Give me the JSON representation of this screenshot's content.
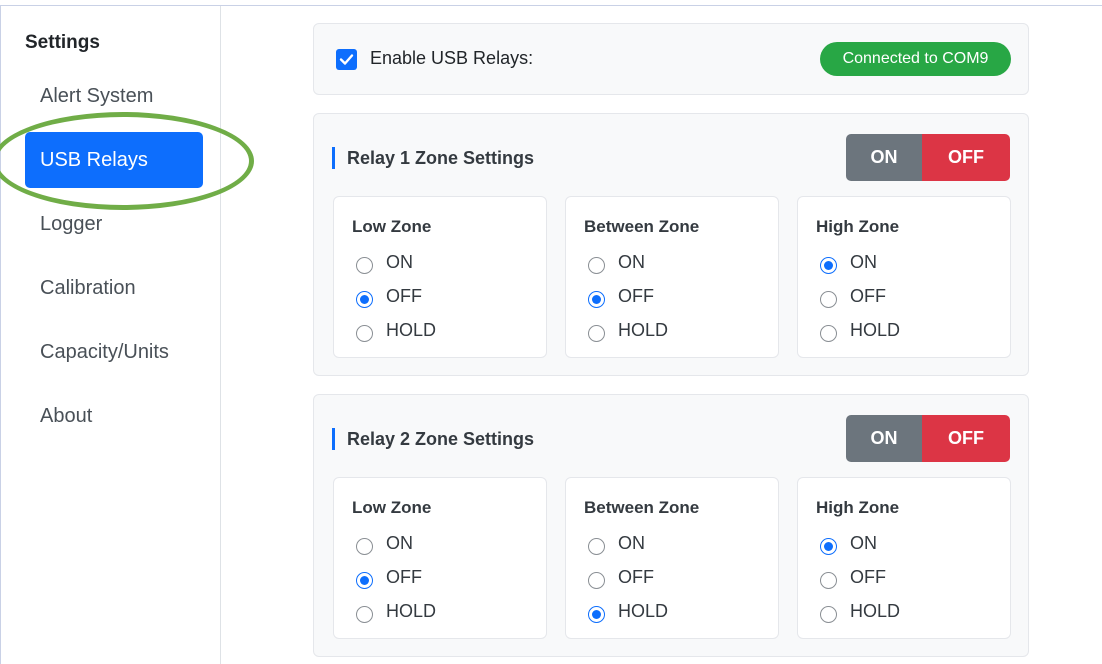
{
  "sidebar": {
    "title": "Settings",
    "items": [
      {
        "label": "Alert System",
        "active": false
      },
      {
        "label": "USB Relays",
        "active": true
      },
      {
        "label": "Logger",
        "active": false
      },
      {
        "label": "Calibration",
        "active": false
      },
      {
        "label": "Capacity/Units",
        "active": false
      },
      {
        "label": "About",
        "active": false
      }
    ]
  },
  "enable": {
    "label": "Enable USB Relays:",
    "checked": true,
    "status": "Connected to COM9"
  },
  "relays": [
    {
      "title": "Relay 1 Zone Settings",
      "on_label": "ON",
      "off_label": "OFF",
      "zones": [
        {
          "title": "Low Zone",
          "options": [
            "ON",
            "OFF",
            "HOLD"
          ],
          "selected": "OFF"
        },
        {
          "title": "Between Zone",
          "options": [
            "ON",
            "OFF",
            "HOLD"
          ],
          "selected": "OFF"
        },
        {
          "title": "High Zone",
          "options": [
            "ON",
            "OFF",
            "HOLD"
          ],
          "selected": "ON"
        }
      ]
    },
    {
      "title": "Relay 2 Zone Settings",
      "on_label": "ON",
      "off_label": "OFF",
      "zones": [
        {
          "title": "Low Zone",
          "options": [
            "ON",
            "OFF",
            "HOLD"
          ],
          "selected": "OFF"
        },
        {
          "title": "Between Zone",
          "options": [
            "ON",
            "OFF",
            "HOLD"
          ],
          "selected": "HOLD"
        },
        {
          "title": "High Zone",
          "options": [
            "ON",
            "OFF",
            "HOLD"
          ],
          "selected": "ON"
        }
      ]
    }
  ],
  "colors": {
    "accent": "#0d6efd",
    "success": "#28a745",
    "danger": "#dc3545",
    "secondary": "#6c757d",
    "annotation": "#70ad47"
  }
}
